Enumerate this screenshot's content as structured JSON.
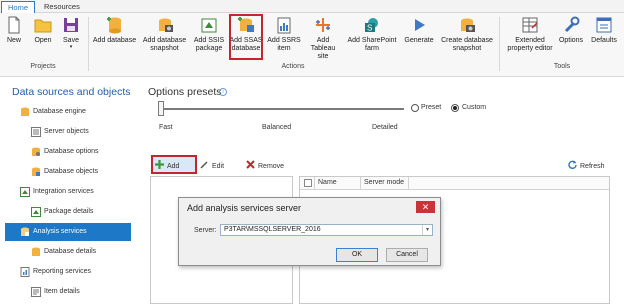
{
  "tabs": {
    "home": "Home",
    "resources": "Resources"
  },
  "ribbon": {
    "projects": {
      "label": "Projects",
      "new": "New",
      "open": "Open",
      "save": "Save"
    },
    "actions": {
      "label": "Actions",
      "add_database": "Add database",
      "add_db_snapshot_1": "Add database",
      "add_db_snapshot_2": "snapshot",
      "add_ssis_1": "Add SSIS",
      "add_ssis_2": "package",
      "add_ssas_1": "Add SSAS",
      "add_ssas_2": "database",
      "add_ssrs_1": "Add SSRS",
      "add_ssrs_2": "item",
      "add_tableau_1": "Add Tableau",
      "add_tableau_2": "site",
      "add_sharepoint_1": "Add SharePoint",
      "add_sharepoint_2": "farm",
      "generate": "Generate",
      "create_snapshot_1": "Create database",
      "create_snapshot_2": "snapshot"
    },
    "tools": {
      "label": "Tools",
      "extended_1": "Extended",
      "extended_2": "property editor",
      "options": "Options",
      "defaults": "Defaults"
    }
  },
  "left_panel": {
    "title": "Data sources and objects",
    "items": [
      {
        "label": "Database engine"
      },
      {
        "label": "Server objects"
      },
      {
        "label": "Database options"
      },
      {
        "label": "Database objects"
      },
      {
        "label": "Integration services"
      },
      {
        "label": "Package details"
      },
      {
        "label": "Analysis services"
      },
      {
        "label": "Database details"
      },
      {
        "label": "Reporting services"
      },
      {
        "label": "Item details"
      }
    ]
  },
  "options": {
    "title": "Options presets",
    "levels": {
      "fast": "Fast",
      "balanced": "Balanced",
      "detailed": "Detailed"
    },
    "preset": "Preset",
    "custom": "Custom",
    "selected": "Custom"
  },
  "toolbar": {
    "add": "Add",
    "edit": "Edit",
    "remove": "Remove",
    "refresh": "Refresh"
  },
  "grid": {
    "col_name": "Name",
    "col_server_mode": "Server mode"
  },
  "dialog": {
    "title": "Add analysis services server",
    "server_label": "Server:",
    "server_value": "P3TAR\\MSSQLSERVER_2016",
    "ok": "OK",
    "cancel": "Cancel"
  },
  "colors": {
    "accent": "#1e78c8",
    "highlight": "#c0282e",
    "close": "#c8343a"
  }
}
